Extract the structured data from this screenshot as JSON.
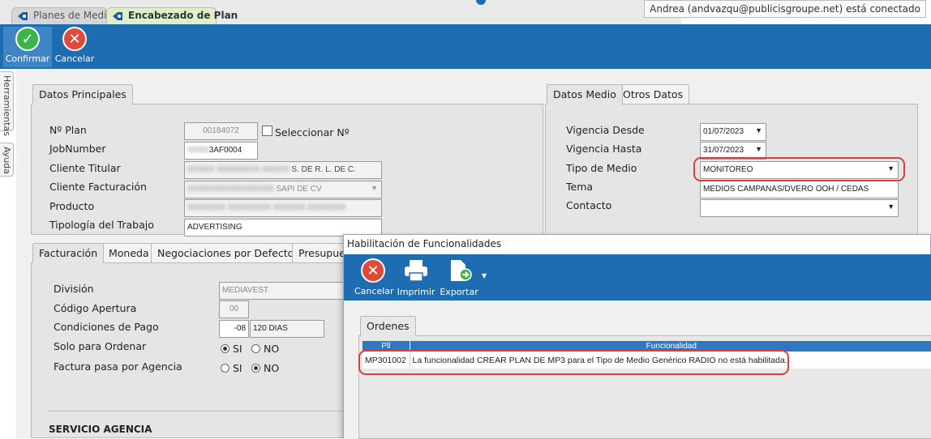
{
  "tabs": [
    "Planes de Medios",
    "Encabezado de Plan"
  ],
  "user_status": "Andrea (andvazqu@publicisgroupe.net) está conectado",
  "toolbar": {
    "confirm_label": "Confirmar",
    "cancel_label": "Cancelar"
  },
  "side_tabs": [
    "Herramientas",
    "Ayuda"
  ],
  "datos_principales": {
    "tab": "Datos Principales",
    "fields": {
      "nplan_label": "Nº Plan",
      "nplan_value": "00184072",
      "seleccionar_label": "Seleccionar Nº",
      "jobnumber_label": "JobNumber",
      "jobnumber_value": "3AF0004",
      "cliente_titular_label": "Cliente Titular",
      "cliente_titular_value": "S. DE R. L. DE C.",
      "cliente_facturacion_label": "Cliente Facturación",
      "cliente_facturacion_value": "SAPI DE CV",
      "producto_label": "Producto",
      "tipologia_label": "Tipología del Trabajo",
      "tipologia_value": "ADVERTISING"
    }
  },
  "datos_medio": {
    "tabs": [
      "Datos Medio",
      "Otros Datos"
    ],
    "vigencia_desde_label": "Vigencia Desde",
    "vigencia_desde_value": "01/07/2023",
    "vigencia_hasta_label": "Vigencia Hasta",
    "vigencia_hasta_value": "31/07/2023",
    "tipo_medio_label": "Tipo de Medio",
    "tipo_medio_value": "MONITOREO",
    "tema_label": "Tema",
    "tema_value": "MEDIOS CAMPANAS/DVERO OOH / CEDAS",
    "contacto_label": "Contacto"
  },
  "facturacion": {
    "tabs": [
      "Facturación",
      "Moneda",
      "Negociaciones por Defecto",
      "Presupuesto"
    ],
    "division_label": "División",
    "division_value": "MEDIAVEST",
    "codigo_apertura_label": "Código Apertura",
    "codigo_apertura_value": "00",
    "condiciones_pago_label": "Condiciones de Pago",
    "condiciones_pago_code": "-08",
    "condiciones_pago_value": "120 DIAS",
    "solo_ordenar_label": "Solo para Ordenar",
    "factura_agencia_label": "Factura pasa por Agencia",
    "si_label": "SI",
    "no_label": "NO",
    "servicio_agencia_label": "SERVICIO AGENCIA"
  },
  "dialog": {
    "title": "Habilitación de Funcionalidades",
    "toolbar": {
      "cancel_label": "Cancelar",
      "print_label": "Imprimir",
      "export_label": "Exportar"
    },
    "tab": "Ordenes",
    "columns": [
      "Pll",
      "Funcionalidad"
    ],
    "rows": [
      {
        "code": "MP301002",
        "text": "La funcionalidad CREAR PLAN DE MP3 para el Tipo de Medio Genérico RADIO no está habilitada."
      }
    ]
  },
  "colors": {
    "toolbar_blue": "#1e6db3",
    "highlight_red": "#d9403a",
    "confirm_green": "#3bb54a",
    "cancel_red": "#e04a3a"
  }
}
